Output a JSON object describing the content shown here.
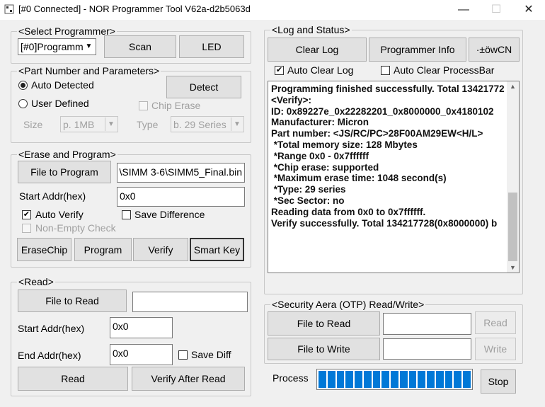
{
  "window": {
    "title": "[#0 Connected]  - NOR Programmer Tool V62a-d2b5063d",
    "minimize": "—",
    "maximize": "☐",
    "close": "✕"
  },
  "select_programmer": {
    "title": "<Select Programmer>",
    "dropdown_value": "[#0]Programm",
    "scan_label": "Scan",
    "led_label": "LED"
  },
  "part": {
    "title": "<Part Number and Parameters>",
    "auto_detected": "Auto Detected",
    "user_defined": "User Defined",
    "detect_label": "Detect",
    "chip_erase": "Chip Erase",
    "size_label": "Size",
    "size_value": "p. 1MB",
    "type_label": "Type",
    "type_value": "b. 29 Series",
    "auto_detected_selected": true
  },
  "erase_program": {
    "title": "<Erase and Program>",
    "file_to_program_label": "File to Program",
    "file_path": "\\SIMM 3-6\\SIMM5_Final.bin",
    "start_addr_label": "Start Addr(hex)",
    "start_addr_value": "0x0",
    "auto_verify": "Auto Verify",
    "auto_verify_checked": true,
    "save_difference": "Save Difference",
    "save_difference_checked": false,
    "non_empty_check": "Non-Empty Check",
    "erase_chip_label": "EraseChip",
    "program_label": "Program",
    "verify_label": "Verify",
    "smart_key_label": "Smart Key"
  },
  "read": {
    "title": "<Read>",
    "file_to_read_label": "File to Read",
    "file_to_read_value": "",
    "start_addr_label": "Start Addr(hex)",
    "start_addr_value": "0x0",
    "end_addr_label": "End Addr(hex)",
    "end_addr_value": "0x0",
    "save_diff": "Save Diff",
    "save_diff_checked": false,
    "read_label": "Read",
    "verify_after_read_label": "Verify After Read"
  },
  "log": {
    "title": "<Log and Status>",
    "clear_log_label": "Clear Log",
    "programmer_info_label": "Programmer Info",
    "extra_label": "·±öwCN",
    "auto_clear_log": "Auto Clear Log",
    "auto_clear_log_checked": true,
    "auto_clear_processbar": "Auto Clear ProcessBar",
    "auto_clear_processbar_checked": false,
    "lines": [
      "Programming finished successfully. Total 13421772",
      "",
      "<Verify>:",
      "ID: 0x89227e_0x22282201_0x8000000_0x4180102",
      "Manufacturer: Micron",
      "Part number: <JS/RC/PC>28F00AM29EW<H/L>",
      " *Total memory size: 128 Mbytes",
      " *Range 0x0 - 0x7ffffff",
      " *Chip erase: supported",
      " *Maximum erase time: 1048 second(s)",
      " *Type: 29 series",
      " *Sec Sector: no",
      "Reading data from 0x0 to 0x7ffffff.",
      "Verify successfully. Total 134217728(0x8000000) b"
    ]
  },
  "otp": {
    "title": "<Security Aera (OTP) Read/Write>",
    "file_to_read_label": "File to Read",
    "file_to_read_value": "",
    "read_label": "Read",
    "file_to_write_label": "File to Write",
    "file_to_write_value": "",
    "write_label": "Write"
  },
  "process": {
    "label": "Process",
    "segments": 17,
    "progress_fraction": 1.0,
    "stop_label": "Stop",
    "bar_color": "#0078d7"
  }
}
